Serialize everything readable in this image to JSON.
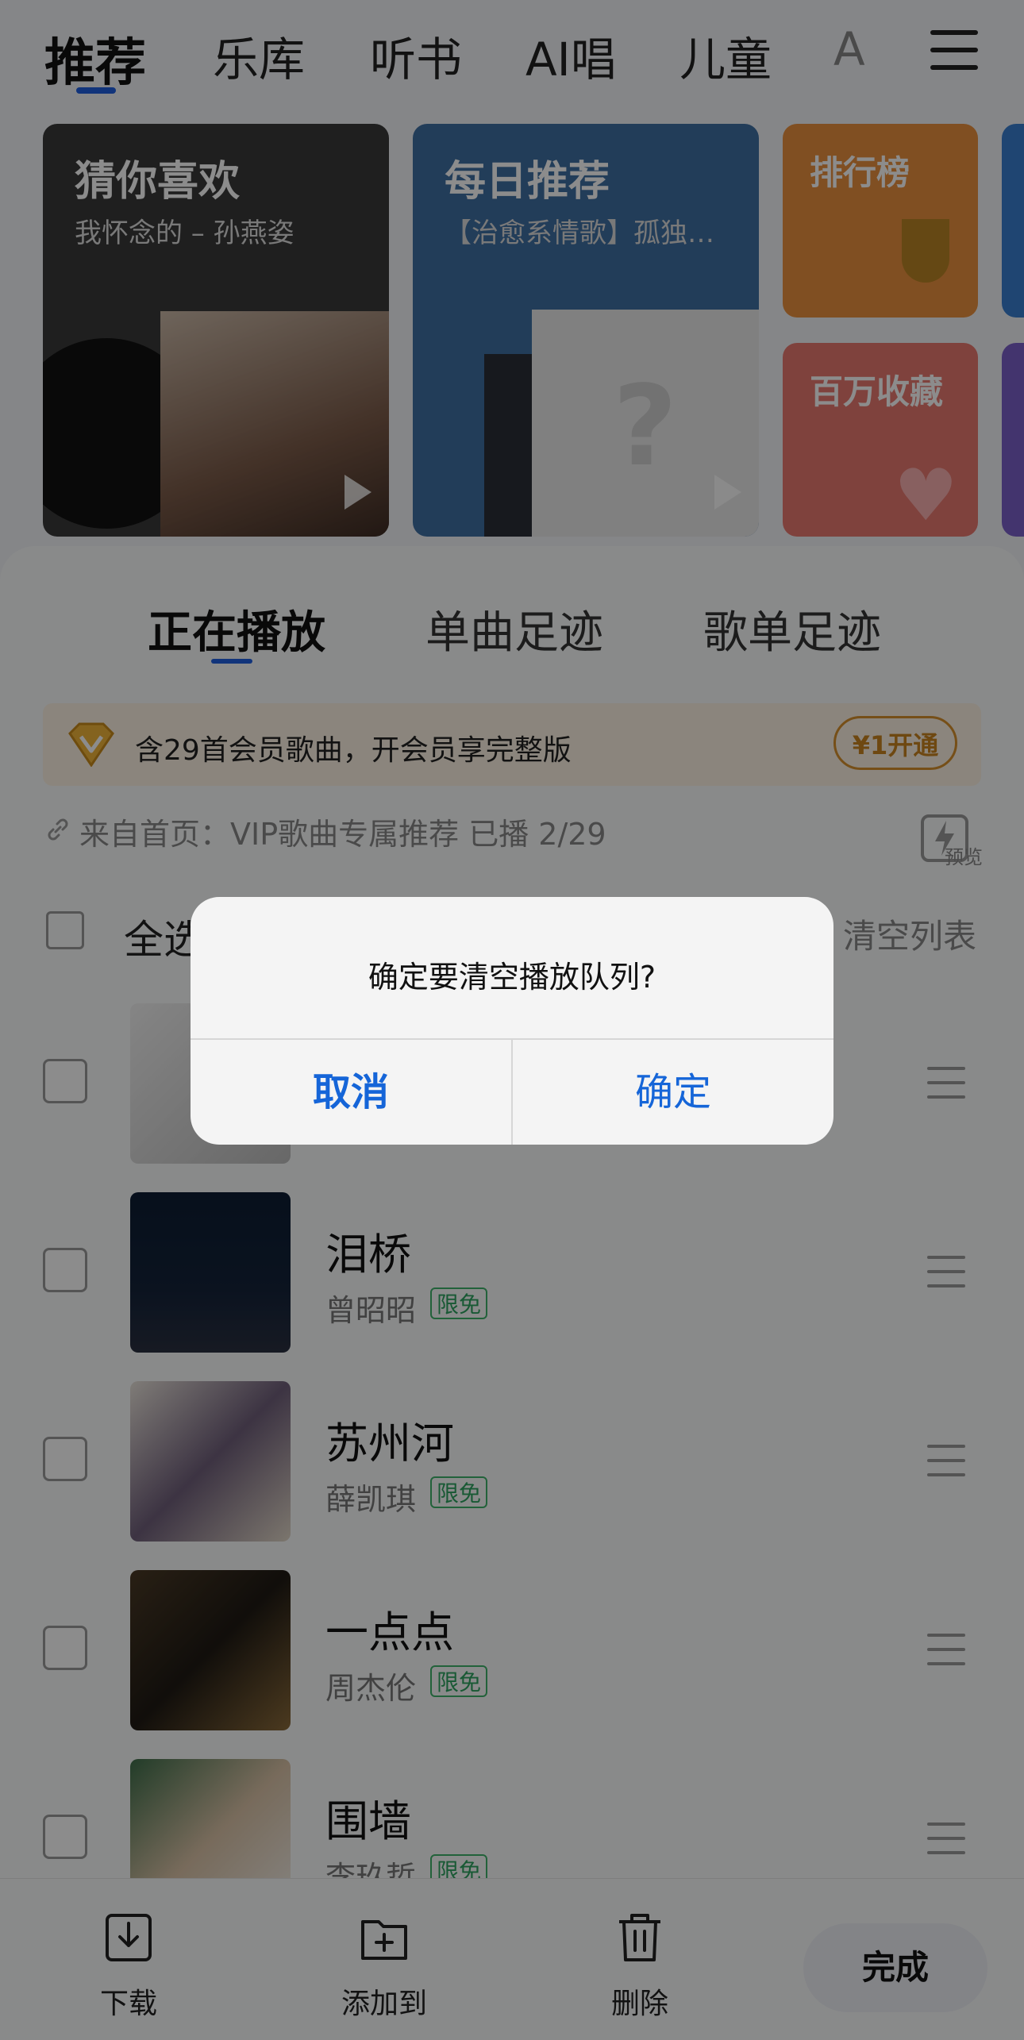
{
  "top_nav": {
    "tabs": [
      "推荐",
      "乐库",
      "听书",
      "AI唱",
      "儿童",
      "A"
    ],
    "active_tab": "推荐"
  },
  "cards": {
    "guess": {
      "title": "猜你喜欢",
      "subtitle": "我怀念的 – 孙燕姿"
    },
    "daily": {
      "title": "每日推荐",
      "subtitle": "【治愈系情歌】孤独…"
    },
    "chart": {
      "title": "排行榜"
    },
    "collect": {
      "title": "百万收藏"
    }
  },
  "sheet": {
    "tabs": [
      "正在播放",
      "单曲足迹",
      "歌单足迹"
    ],
    "active_tab": "正在播放",
    "vip_banner": {
      "text": "含29首会员歌曲，开会员享完整版",
      "button": "¥1开通"
    },
    "source": "来自首页：VIP歌曲专属推荐  已播 2/29",
    "preview_label": "预览",
    "select_all": "全选",
    "clear_list": "清空列表",
    "songs": [
      {
        "title": "",
        "artist": "",
        "tag": ""
      },
      {
        "title": "泪桥",
        "artist": "曾昭昭",
        "tag": "限免"
      },
      {
        "title": "苏州河",
        "artist": "薛凯琪",
        "tag": "限免"
      },
      {
        "title": "一点点",
        "artist": "周杰伦",
        "tag": "限免"
      },
      {
        "title": "围墙",
        "artist": "李玖哲",
        "tag": "限免"
      }
    ],
    "toolbar": {
      "download": "下载",
      "add_to": "添加到",
      "delete": "删除",
      "done": "完成"
    }
  },
  "dialog": {
    "message": "确定要清空播放队列?",
    "cancel": "取消",
    "confirm": "确定"
  },
  "colors": {
    "accent": "#1f5fe0",
    "dialog_button": "#1565d8",
    "vip": "#d7902c",
    "tag_green": "#2da35f"
  }
}
